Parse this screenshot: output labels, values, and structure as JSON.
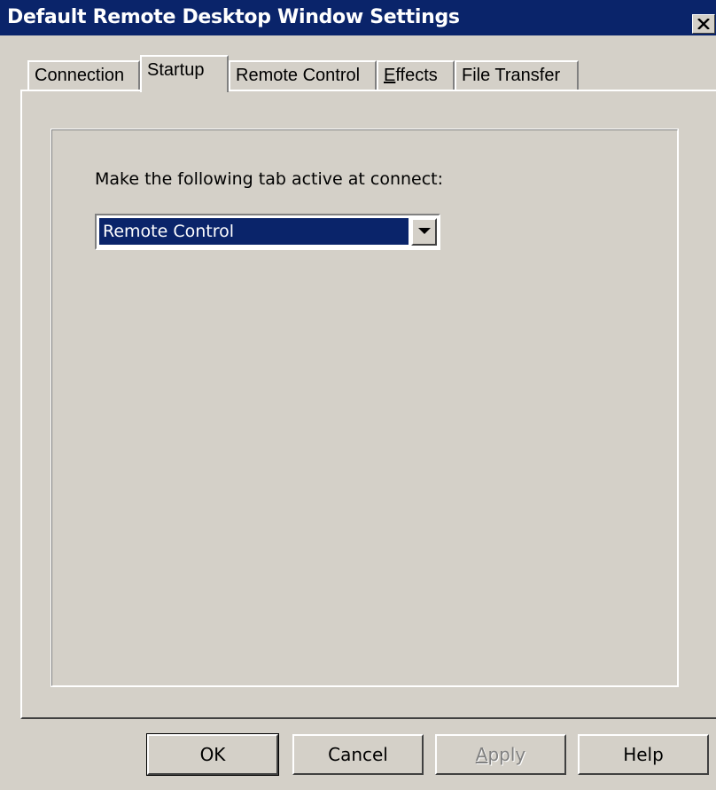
{
  "window": {
    "title": "Default Remote Desktop Window Settings",
    "close_glyph": "✕"
  },
  "tabs": [
    {
      "label": "Connection",
      "active": false
    },
    {
      "label": "Startup",
      "active": true
    },
    {
      "label": "Remote Control",
      "active": false
    },
    {
      "label_prefix": "",
      "label_access": "E",
      "label_rest": "ffects",
      "active": false
    },
    {
      "label": "File Transfer",
      "active": false
    }
  ],
  "startup": {
    "active_tab_label": "Make the following tab active at connect:",
    "active_tab_value": "Remote Control"
  },
  "buttons": {
    "ok": "OK",
    "cancel": "Cancel",
    "apply_access": "A",
    "apply_rest": "pply",
    "help": "Help"
  },
  "colors": {
    "face": "#d4d0c8",
    "titlebar": "#0a246a",
    "selection": "#0a246a"
  }
}
